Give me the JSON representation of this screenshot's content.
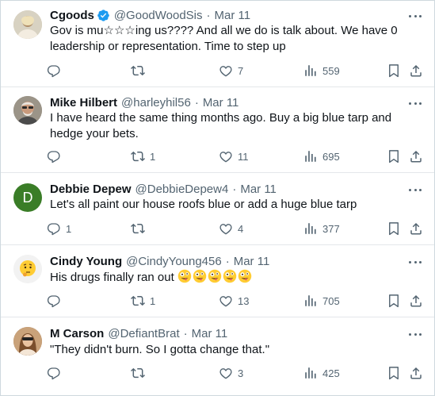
{
  "colors": {
    "verified_badge": "#1d9bf0",
    "muted_text": "#536471",
    "primary_text": "#0f1419",
    "divider": "#e4e7ea",
    "avatar_debbie": "#3a7d27"
  },
  "tweets": [
    {
      "name": "Cgoods",
      "verified": true,
      "handle": "@GoodWoodSis",
      "separator": "·",
      "time": "Mar 11",
      "text": "Gov is mu☆☆☆ing us???? And all we do is talk about. We have 0 leadership or representation. Time to step up",
      "replies": "",
      "reposts": "",
      "likes": "7",
      "views": "559",
      "avatar_icon": "profile-photo"
    },
    {
      "name": "Mike Hilbert",
      "verified": false,
      "handle": "@harleyhil56",
      "separator": "·",
      "time": "Mar 11",
      "text": "I have heard the same thing months ago. Buy a big blue tarp and hedge your bets.",
      "replies": "",
      "reposts": "1",
      "likes": "11",
      "views": "695",
      "avatar_icon": "profile-photo"
    },
    {
      "name": "Debbie Depew",
      "verified": false,
      "handle": "@DebbieDepew4",
      "separator": "·",
      "time": "Mar 11",
      "text": "Let's all paint our house roofs blue or add a huge blue tarp",
      "replies": "1",
      "reposts": "",
      "likes": "4",
      "views": "377",
      "avatar_letter": "D"
    },
    {
      "name": "Cindy Young",
      "verified": false,
      "handle": "@CindyYoung456",
      "separator": "·",
      "time": "Mar 11",
      "text": "His drugs finally ran out",
      "text_emojis": [
        "zany-face-emoji",
        "zany-face-emoji",
        "zany-face-emoji",
        "zany-face-emoji",
        "zany-face-emoji"
      ],
      "replies": "",
      "reposts": "1",
      "likes": "13",
      "views": "705",
      "avatar_icon": "thinking-face-emoji"
    },
    {
      "name": "M Carson",
      "verified": false,
      "handle": "@DefiantBrat",
      "separator": "·",
      "time": "Mar 11",
      "text": "\"They didn't burn. So I gotta change that.\"",
      "replies": "",
      "reposts": "",
      "likes": "3",
      "views": "425",
      "avatar_icon": "profile-photo"
    }
  ]
}
